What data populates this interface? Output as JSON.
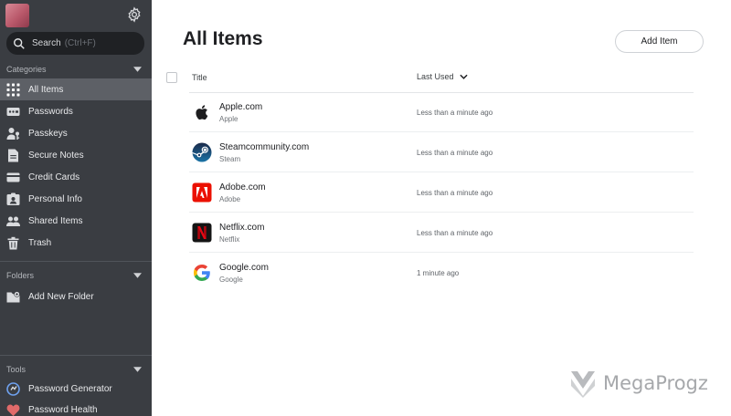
{
  "sidebar": {
    "search": {
      "label": "Search",
      "shortcut": "(Ctrl+F)"
    },
    "categories_header": "Categories",
    "categories": [
      {
        "label": "All Items",
        "icon": "grid-icon",
        "active": true
      },
      {
        "label": "Passwords",
        "icon": "password-icon"
      },
      {
        "label": "Passkeys",
        "icon": "passkey-icon"
      },
      {
        "label": "Secure Notes",
        "icon": "note-icon"
      },
      {
        "label": "Credit Cards",
        "icon": "credit-card-icon"
      },
      {
        "label": "Personal Info",
        "icon": "id-card-icon"
      },
      {
        "label": "Shared Items",
        "icon": "shared-users-icon"
      },
      {
        "label": "Trash",
        "icon": "trash-icon"
      }
    ],
    "folders_header": "Folders",
    "folders": [
      {
        "label": "Add New Folder",
        "icon": "add-folder-icon"
      }
    ],
    "tools_header": "Tools",
    "tools": [
      {
        "label": "Password Generator",
        "icon": "generator-icon"
      },
      {
        "label": "Password Health",
        "icon": "health-icon"
      }
    ]
  },
  "main": {
    "title": "All Items",
    "add_button": "Add Item",
    "columns": {
      "title": "Title",
      "last_used": "Last Used"
    },
    "items": [
      {
        "name": "Apple.com",
        "sub": "Apple",
        "last_used": "Less than a minute ago",
        "icon": "apple-logo-icon"
      },
      {
        "name": "Steamcommunity.com",
        "sub": "Steam",
        "last_used": "Less than a minute ago",
        "icon": "steam-logo-icon"
      },
      {
        "name": "Adobe.com",
        "sub": "Adobe",
        "last_used": "Less than a minute ago",
        "icon": "adobe-logo-icon"
      },
      {
        "name": "Netflix.com",
        "sub": "Netflix",
        "last_used": "Less than a minute ago",
        "icon": "netflix-logo-icon"
      },
      {
        "name": "Google.com",
        "sub": "Google",
        "last_used": "1 minute ago",
        "icon": "google-logo-icon"
      }
    ]
  },
  "watermark": {
    "text": "MegaProgz"
  },
  "colors": {
    "sidebar_bg": "#3a3d42",
    "active_item": "#5d6066",
    "search_bg": "#1f2124"
  }
}
